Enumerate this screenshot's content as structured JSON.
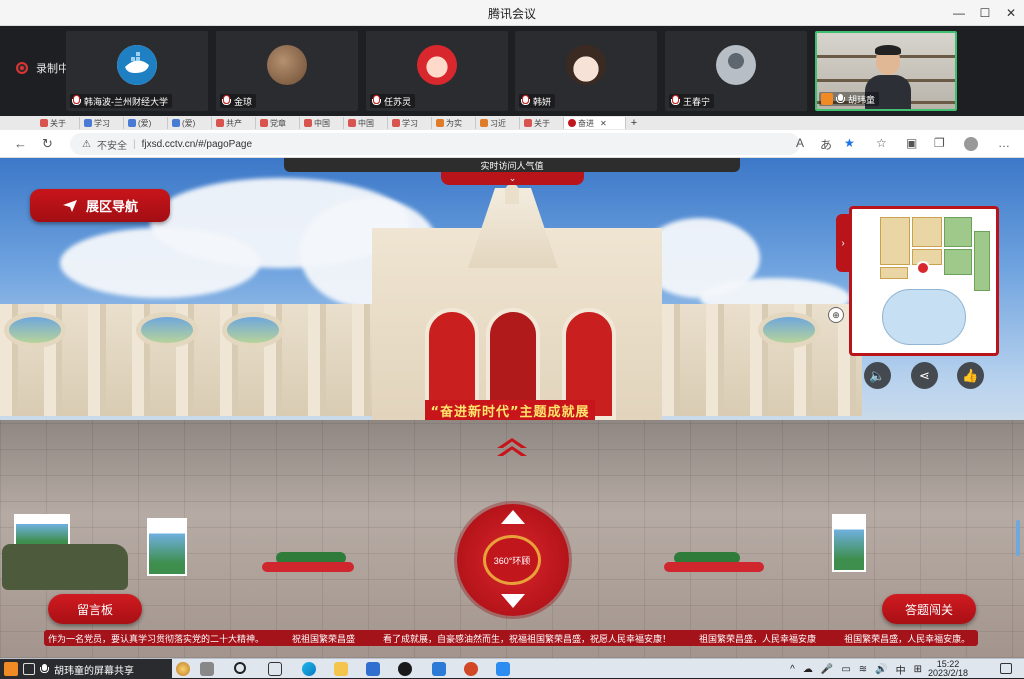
{
  "window": {
    "title": "腾讯会议",
    "controls": [
      "—",
      "☐",
      "✕"
    ]
  },
  "meeting": {
    "recording_label": "录制中",
    "participants": [
      {
        "name": "韩海波-兰州财经大学",
        "avatar_color": "#1e7fc2",
        "avatar_icon": "whale-icon"
      },
      {
        "name": "金琼",
        "avatar_color": "#8b6b4a",
        "avatar_icon": "photo-avatar"
      },
      {
        "name": "任苏灵",
        "avatar_color": "#d8282e",
        "avatar_icon": "cartoon-avatar"
      },
      {
        "name": "韩妍",
        "avatar_color": "#f2e6df",
        "avatar_icon": "girl-avatar"
      },
      {
        "name": "王春宁",
        "avatar_color": "#9aa3ad",
        "avatar_icon": "silhouette-avatar"
      },
      {
        "name": "胡玮童",
        "avatar_color": "#3fbf6f",
        "avatar_icon": "camera-feed"
      }
    ]
  },
  "browser": {
    "tabs": [
      "关于",
      "学习",
      "(爱)",
      "(爱)",
      "共产",
      "党章",
      "中国",
      "中国",
      "学习",
      "为实",
      "习近",
      "关于",
      "奋进"
    ],
    "address": {
      "security": "不安全",
      "url": "fjxsd.cctv.cn/#/pagoPage"
    },
    "toolbar_icons": [
      "read-aloud-icon",
      "translate-icon",
      "favorite-star-icon",
      "favorites-icon",
      "split-screen-icon",
      "collections-icon",
      "profile-icon",
      "more-icon"
    ]
  },
  "exhibit": {
    "nav_button": "展区导航",
    "visit_bar": "实时访问人气值",
    "hall_banner": "“奋进新时代”主题成就展",
    "joystick_center": "360°环顾",
    "message_board": "留言板",
    "quiz_button": "答题闯关",
    "ticker": [
      "作为一名党员，要认真学习贯彻落实党的二十大精神。",
      "祝祖国繁荣昌盛",
      "看了成就展，自豪感油然而生，祝福祖国繁荣昌盛，祝愿人民幸福安康！",
      "祖国繁荣昌盛，人民幸福安康",
      "祖国繁荣昌盛，人民幸福安康。"
    ],
    "accent_color": "#c8151b"
  },
  "taskbar": {
    "sharing_label": "胡玮童的屏幕共享",
    "ime": "中",
    "time": "15:22",
    "date": "2023/2/18"
  }
}
